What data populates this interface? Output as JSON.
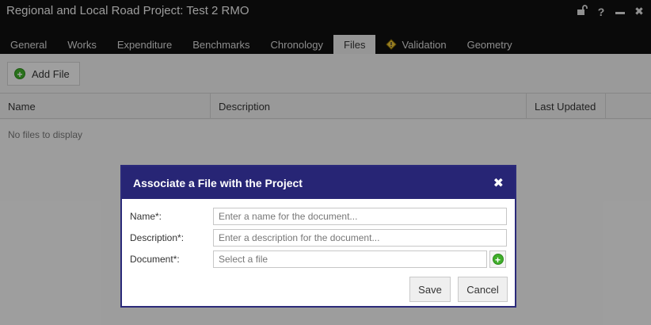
{
  "window": {
    "title": "Regional and Local Road Project: Test 2 RMO",
    "icons": [
      "unlock-icon",
      "help-icon",
      "minimize-icon",
      "close-icon"
    ]
  },
  "tabs": [
    {
      "label": "General"
    },
    {
      "label": "Works"
    },
    {
      "label": "Expenditure"
    },
    {
      "label": "Benchmarks"
    },
    {
      "label": "Chronology"
    },
    {
      "label": "Files",
      "active": true
    },
    {
      "label": "Validation",
      "icon": "warning-icon"
    },
    {
      "label": "Geometry"
    }
  ],
  "toolbar": {
    "add_file_label": "Add File"
  },
  "grid": {
    "columns": [
      "Name",
      "Description",
      "Last Updated"
    ],
    "empty_message": "No files to display"
  },
  "dialog": {
    "title": "Associate a File with the Project",
    "fields": {
      "name": {
        "label": "Name*:",
        "placeholder": "Enter a name for the document..."
      },
      "description": {
        "label": "Description*:",
        "placeholder": "Enter a description for the document..."
      },
      "document": {
        "label": "Document*:",
        "placeholder": "Select a file"
      }
    },
    "save_label": "Save",
    "cancel_label": "Cancel"
  },
  "colors": {
    "titlebar": "#101010",
    "dialog_header": "#272575",
    "add_icon": "#3fae2a"
  }
}
